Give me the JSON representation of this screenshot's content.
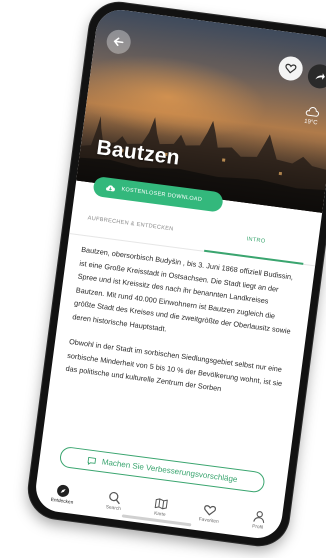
{
  "place": {
    "title": "Bautzen"
  },
  "hero": {
    "weather_label": "19°C"
  },
  "download_button": {
    "label": "KOSTENLOSER DOWNLOAD"
  },
  "tabs": [
    {
      "label": "AUFBRECHEN & ENTDECKEN"
    },
    {
      "label": "INTRO"
    }
  ],
  "description": {
    "paragraphs": [
      "Bautzen, obersorbisch Budyšin , bis 3. Juni 1868 offiziell Budissin, ist eine Große Kreisstadt in Ostsachsen. Die Stadt liegt an der Spree und ist Kreissitz des nach ihr benannten Landkreises Bautzen. Mit rund 40.000 Einwohnern ist Bautzen zugleich die größte Stadt des Kreises und die zweitgrößte der Oberlausitz sowie deren historische Hauptstadt.",
      "Obwohl in der Stadt im sorbischen Siedlungsgebiet selbst nur eine sorbische Minderheit von 5 bis 10 % der Bevölkerung wohnt, ist sie das politische und kulturelle Zentrum der Sorben"
    ]
  },
  "suggest_button": {
    "label": "Machen Sie Verbesserungsvorschläge"
  },
  "bottom_nav": [
    {
      "label": "Entdecken",
      "icon": "compass-icon",
      "active": true
    },
    {
      "label": "Search",
      "icon": "search-icon"
    },
    {
      "label": "Karte",
      "icon": "map-icon"
    },
    {
      "label": "Favoriten",
      "icon": "heart-icon"
    },
    {
      "label": "Profil",
      "icon": "person-icon"
    }
  ],
  "colors": {
    "accent": "#3aa56f",
    "download_bg": "#33b87c",
    "phone_frame": "#121212"
  }
}
